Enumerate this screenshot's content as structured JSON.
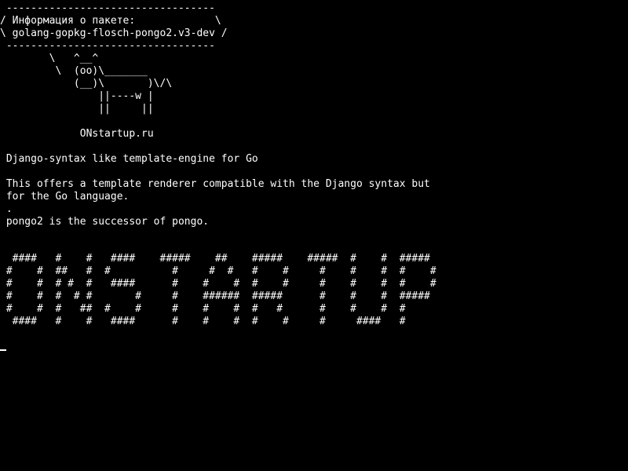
{
  "terminal": {
    "background": "#000000",
    "foreground": "#ffffff",
    "banner": [
      " ----------------------------------",
      "/ Информация о пакете:             \\",
      "\\ golang-gopkg-flosch-pongo2.v3-dev /",
      " ----------------------------------",
      "        \\   ^__^",
      "         \\  (oo)\\_______",
      "            (__)\\       )\\/\\",
      "                ||----w |",
      "                ||     ||"
    ],
    "site": "             ONstartup.ru",
    "short_description": " Django-syntax like template-engine for Go",
    "description": [
      " This offers a template renderer compatible with the Django syntax but",
      " for the Go language.",
      " .",
      " pongo2 is the successor of pongo."
    ],
    "ascii_art": [
      "  ####   #    #   ####    #####    ##    #####    #####  #    #  #####",
      " #    #  ##   #  #          #     #  #   #    #     #    #    #  #    #",
      " #    #  # #  #   ####      #    #    #  #    #     #    #    #  #    #",
      " #    #  #  # #       #     #    ######  #####      #    #    #  #####",
      " #    #  #   ##  #    #     #    #    #  #   #      #    #    #  #",
      "  ####   #    #   ####      #    #    #  #    #     #     ####   #"
    ]
  }
}
